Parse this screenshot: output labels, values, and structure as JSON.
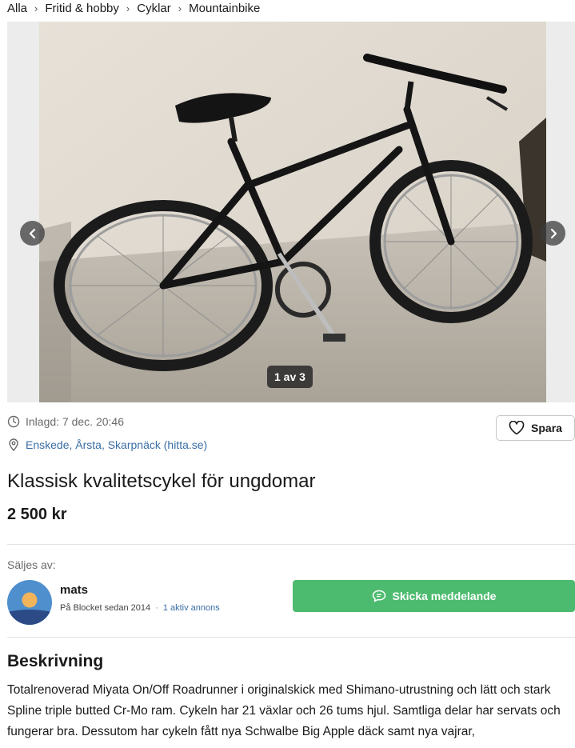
{
  "breadcrumb": [
    "Alla",
    "Fritid & hobby",
    "Cyklar",
    "Mountainbike"
  ],
  "gallery": {
    "counter": "1 av 3",
    "prev_icon": "chevron-left-icon",
    "next_icon": "chevron-right-icon"
  },
  "listing": {
    "posted": "Inlagd: 7 dec. 20:46",
    "location": "Enskede, Årsta, Skarpnäck (hitta.se)",
    "save_label": "Spara",
    "title": "Klassisk kvalitetscykel för ungdomar",
    "price": "2 500 kr"
  },
  "seller": {
    "label": "Säljes av:",
    "name": "mats",
    "since": "På Blocket sedan 2014",
    "ads_link": "1 aktiv annons",
    "message_label": "Skicka meddelande"
  },
  "description": {
    "heading": "Beskrivning",
    "text": "Totalrenoverad Miyata On/Off Roadrunner i originalskick med Shimano-utrustning och lätt och stark Spline triple butted Cr-Mo ram. Cykeln har 21 växlar och 26 tums hjul. Samtliga delar har servats och fungerar bra. Dessutom har cykeln fått nya Schwalbe Big Apple däck samt nya vajrar,"
  },
  "colors": {
    "accent_green": "#4dbb6f",
    "link_blue": "#3a6ea5"
  }
}
